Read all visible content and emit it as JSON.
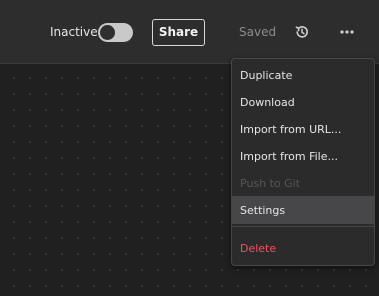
{
  "toolbar": {
    "status_label": "Inactive",
    "active": false,
    "share_label": "Share",
    "save_status": "Saved",
    "history_icon": "history-icon",
    "more_icon": "more-horizontal-icon"
  },
  "menu": {
    "items": [
      {
        "label": "Duplicate"
      },
      {
        "label": "Download"
      },
      {
        "label": "Import from URL..."
      },
      {
        "label": "Import from File..."
      },
      {
        "label": "Push to Git",
        "disabled": true
      },
      {
        "label": "Settings",
        "highlighted": true
      },
      {
        "label": "Delete",
        "danger": true
      }
    ]
  },
  "colors": {
    "canvas_bg": "#202020",
    "toolbar_bg": "#2d2d2e",
    "menu_bg": "#2b2b2c",
    "menu_highlight": "#474749",
    "danger": "#f0535f"
  }
}
